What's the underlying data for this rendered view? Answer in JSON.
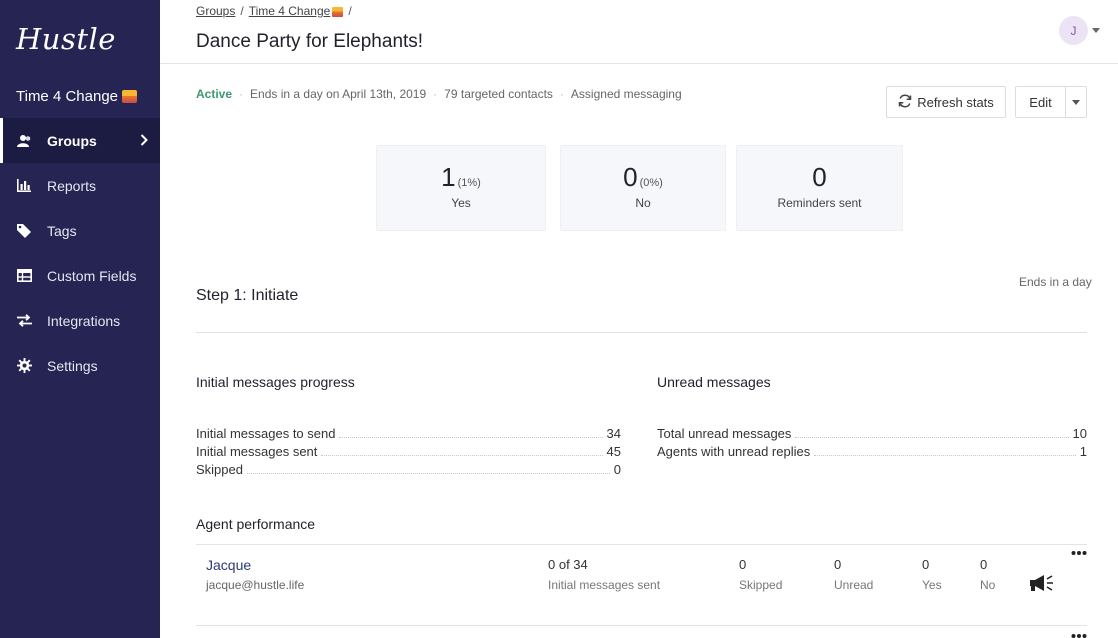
{
  "sidebar": {
    "logo": "Hustle",
    "org_name": "Time 4 Change",
    "items": [
      {
        "label": "Groups",
        "icon": "users-icon",
        "active": true
      },
      {
        "label": "Reports",
        "icon": "bar-chart-icon",
        "active": false
      },
      {
        "label": "Tags",
        "icon": "tag-icon",
        "active": false
      },
      {
        "label": "Custom Fields",
        "icon": "table-icon",
        "active": false
      },
      {
        "label": "Integrations",
        "icon": "swap-arrows-icon",
        "active": false
      },
      {
        "label": "Settings",
        "icon": "gear-icon",
        "active": false
      }
    ]
  },
  "header": {
    "breadcrumb": [
      "Groups",
      "Time 4 Change"
    ],
    "separator": "/",
    "title": "Dance Party for Elephants!",
    "avatar_initial": "J"
  },
  "meta": {
    "status": "Active",
    "ends": "Ends in a day on April 13th, 2019",
    "contacts": "79 targeted contacts",
    "messaging": "Assigned messaging",
    "separator": "·"
  },
  "actions": {
    "refresh_label": "Refresh stats",
    "edit_label": "Edit"
  },
  "stats": [
    {
      "value": "1",
      "pct": "(1%)",
      "label": "Yes"
    },
    {
      "value": "0",
      "pct": "(0%)",
      "label": "No"
    },
    {
      "value": "0",
      "pct": "",
      "label": "Reminders sent"
    }
  ],
  "step": {
    "title": "Step 1: Initiate",
    "ends": "Ends in a day"
  },
  "progress": {
    "title": "Initial messages progress",
    "rows": [
      {
        "label": "Initial messages to send",
        "value": "34"
      },
      {
        "label": "Initial messages sent",
        "value": "45"
      },
      {
        "label": "Skipped",
        "value": "0"
      }
    ]
  },
  "unread": {
    "title": "Unread messages",
    "rows": [
      {
        "label": "Total unread messages",
        "value": "10"
      },
      {
        "label": "Agents with unread replies",
        "value": "1"
      }
    ]
  },
  "agents": {
    "title": "Agent performance",
    "rows": [
      {
        "name": "Jacque",
        "email": "jacque@hustle.life",
        "sent": "0 of 34",
        "sent_label": "Initial messages sent",
        "skipped": "0",
        "skipped_label": "Skipped",
        "unread": "0",
        "unread_label": "Unread",
        "yes": "0",
        "yes_label": "Yes",
        "no": "0",
        "no_label": "No"
      }
    ]
  },
  "colors": {
    "sidebar_bg": "#252452",
    "active_green": "#3b9a6e",
    "link_blue": "#2b3a78",
    "card_bg": "#f5f7fb"
  }
}
